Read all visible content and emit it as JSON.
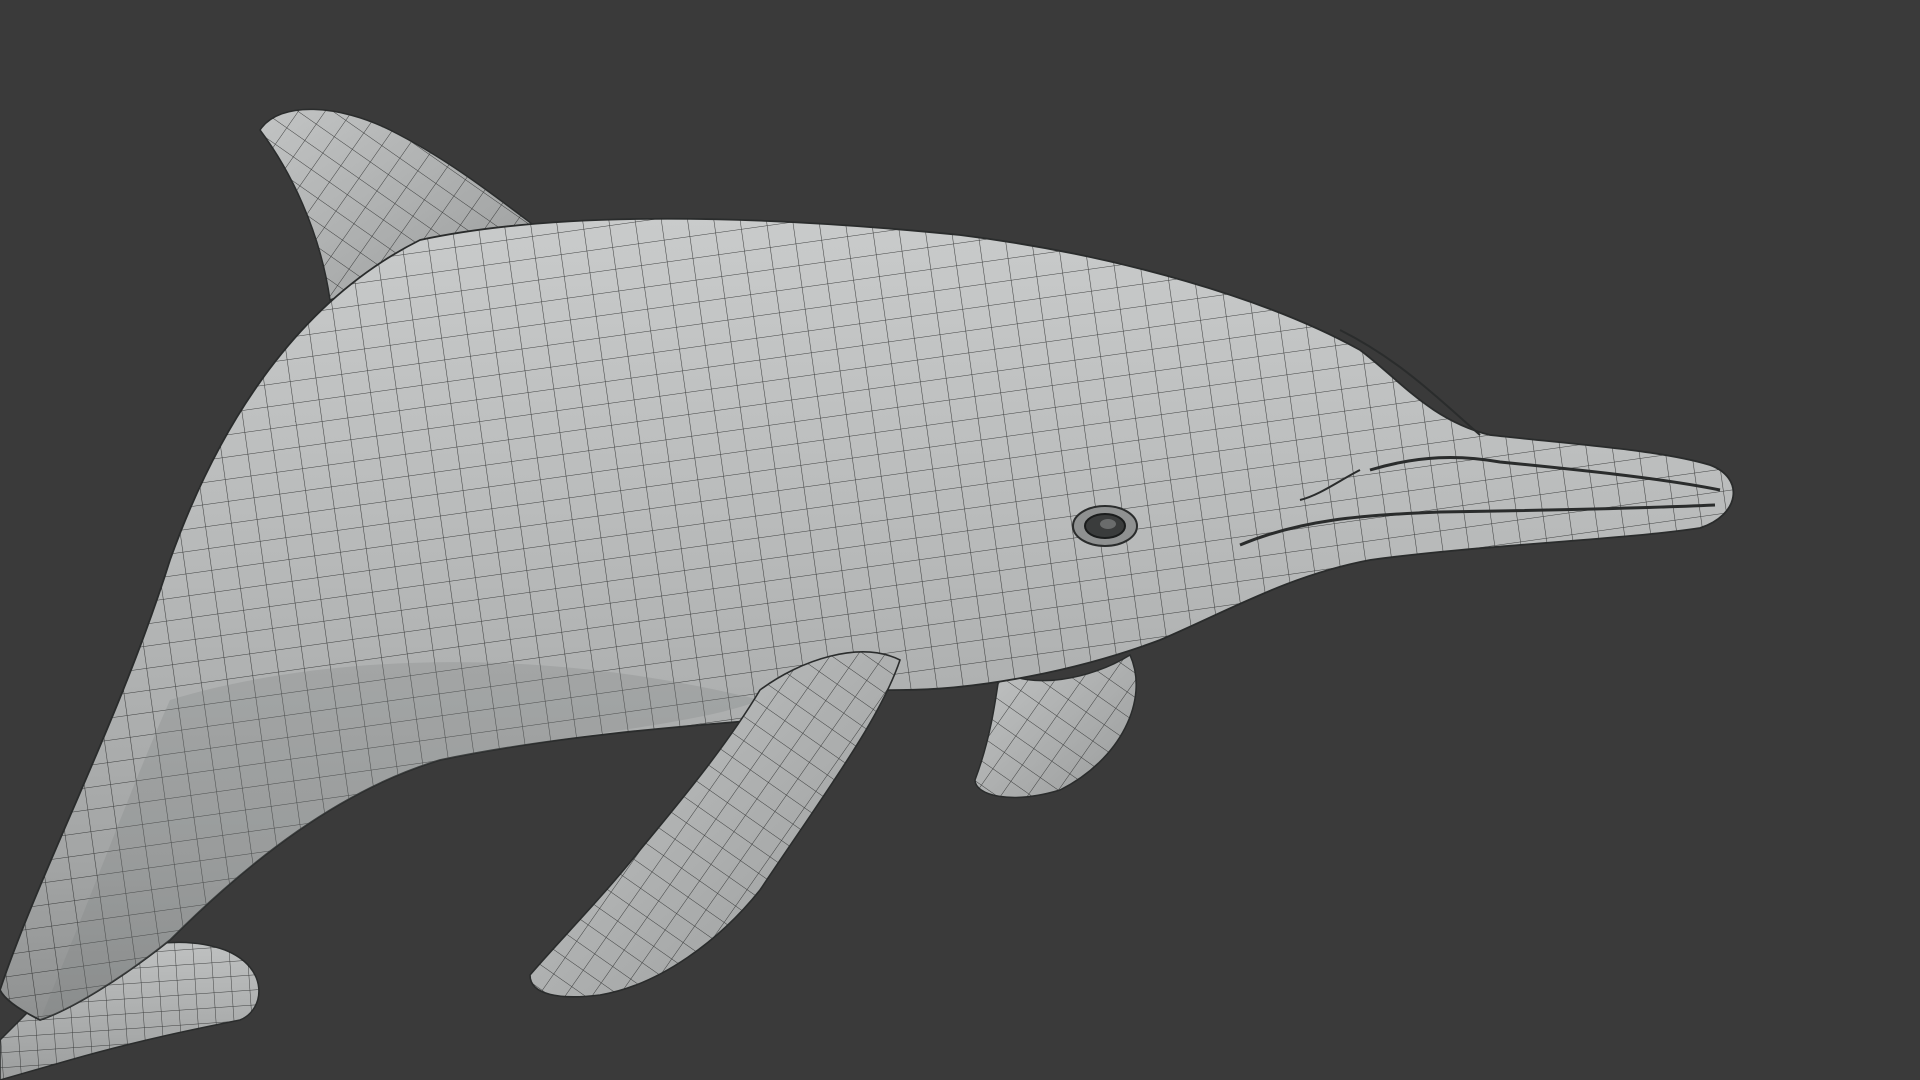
{
  "viewport": {
    "background_color": "#3a3a3a",
    "display_mode": "wireframe-on-shaded",
    "object": {
      "icon": "dolphin-mesh-icon",
      "surface_color": "#b4b6b6",
      "wire_color": "#2a2c2c"
    }
  }
}
